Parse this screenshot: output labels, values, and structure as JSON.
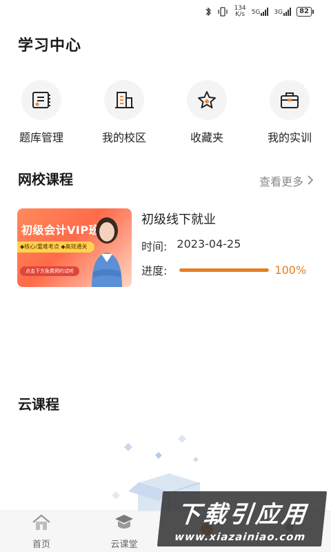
{
  "status_bar": {
    "speed_value": "134",
    "speed_unit": "K/s",
    "sig1": "5G",
    "sig2": "3G",
    "battery": "82"
  },
  "page": {
    "title": "学习中心"
  },
  "quick_entries": [
    {
      "label": "题库管理",
      "icon": "question-bank-icon"
    },
    {
      "label": "我的校区",
      "icon": "building-icon"
    },
    {
      "label": "收藏夹",
      "icon": "star-icon"
    },
    {
      "label": "我的实训",
      "icon": "briefcase-icon"
    }
  ],
  "online_courses": {
    "title": "网校课程",
    "more_label": "查看更多",
    "course": {
      "thumbnail_title": "初级会计VIP班",
      "thumbnail_tags": "◆核心/重难考点 ◆高效通关",
      "thumbnail_cta": "点击下方免费预约试听",
      "name": "初级线下就业",
      "time_label": "时间:",
      "time_value": "2023-04-25",
      "progress_label": "进度:",
      "progress_value": "100%",
      "progress_fraction": 1.0
    }
  },
  "cloud_courses": {
    "title": "云课程"
  },
  "bottom_nav": [
    {
      "label": "首页",
      "icon": "home-icon"
    },
    {
      "label": "云课堂",
      "icon": "cloud-class-icon"
    },
    {
      "label": "",
      "icon": "tab-icon"
    },
    {
      "label": "",
      "icon": "tab-icon"
    }
  ],
  "watermark": {
    "main": "下载引应用",
    "sub": "www.xiazainiao.com"
  },
  "colors": {
    "accent": "#e67e22",
    "nav_bg": "#f6f6f6"
  }
}
